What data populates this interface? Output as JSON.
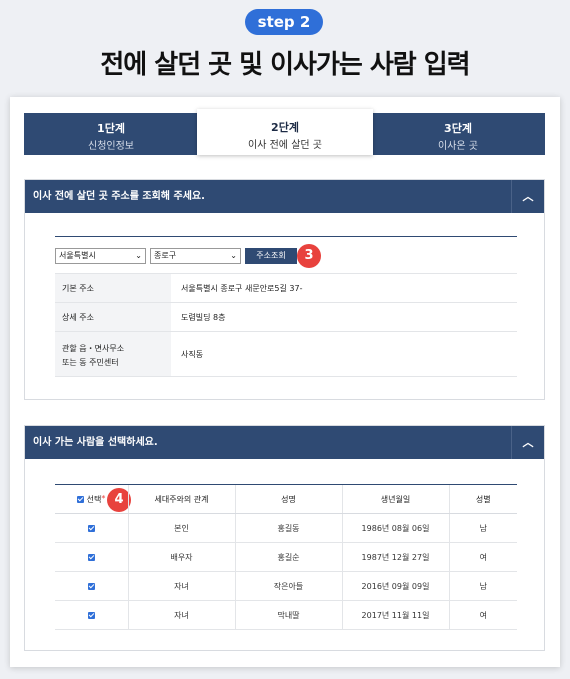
{
  "header": {
    "step_pill": "step 2",
    "title": "전에 살던 곳 및 이사가는 사람 입력"
  },
  "steps": [
    {
      "num": "1단계",
      "desc": "신청인정보"
    },
    {
      "num": "2단계",
      "desc": "이사 전에 살던 곳"
    },
    {
      "num": "3단계",
      "desc": "이사온 곳"
    }
  ],
  "address_section": {
    "title": "이사 전에 살던 곳 주소를 조회해 주세요.",
    "toggle_icon": "chevron-up-icon",
    "province_select": "서울특별시",
    "district_select": "종로구",
    "search_button": "주소조회",
    "badge": "3",
    "rows": [
      {
        "label": "기본 주소",
        "value": "서울특별시 종로구 새문안로5길 37-"
      },
      {
        "label": "상세 주소",
        "value": "도렴빌딩 8층"
      },
      {
        "label1": "관할 읍・면사무소",
        "label2": "또는 동 주민센터",
        "value": "사직동"
      }
    ]
  },
  "people_section": {
    "title": "이사 가는 사람을 선택하세요.",
    "toggle_icon": "chevron-up-icon",
    "badge": "4",
    "required_mark": "*",
    "headers": [
      "선택",
      "세대주와의 관계",
      "성명",
      "생년월일",
      "성별"
    ],
    "rows": [
      {
        "relation": "본인",
        "name": "홍길동",
        "birth": "1986년 08월 06일",
        "gender": "남"
      },
      {
        "relation": "배우자",
        "name": "홍길순",
        "birth": "1987년 12월 27일",
        "gender": "여"
      },
      {
        "relation": "자녀",
        "name": "작은아들",
        "birth": "2016년 09월 09일",
        "gender": "남"
      },
      {
        "relation": "자녀",
        "name": "막내딸",
        "birth": "2017년 11월 11일",
        "gender": "여"
      }
    ]
  },
  "colors": {
    "navy": "#2f4a73",
    "blue": "#2f6fd8",
    "badge_red": "#e8423d"
  }
}
